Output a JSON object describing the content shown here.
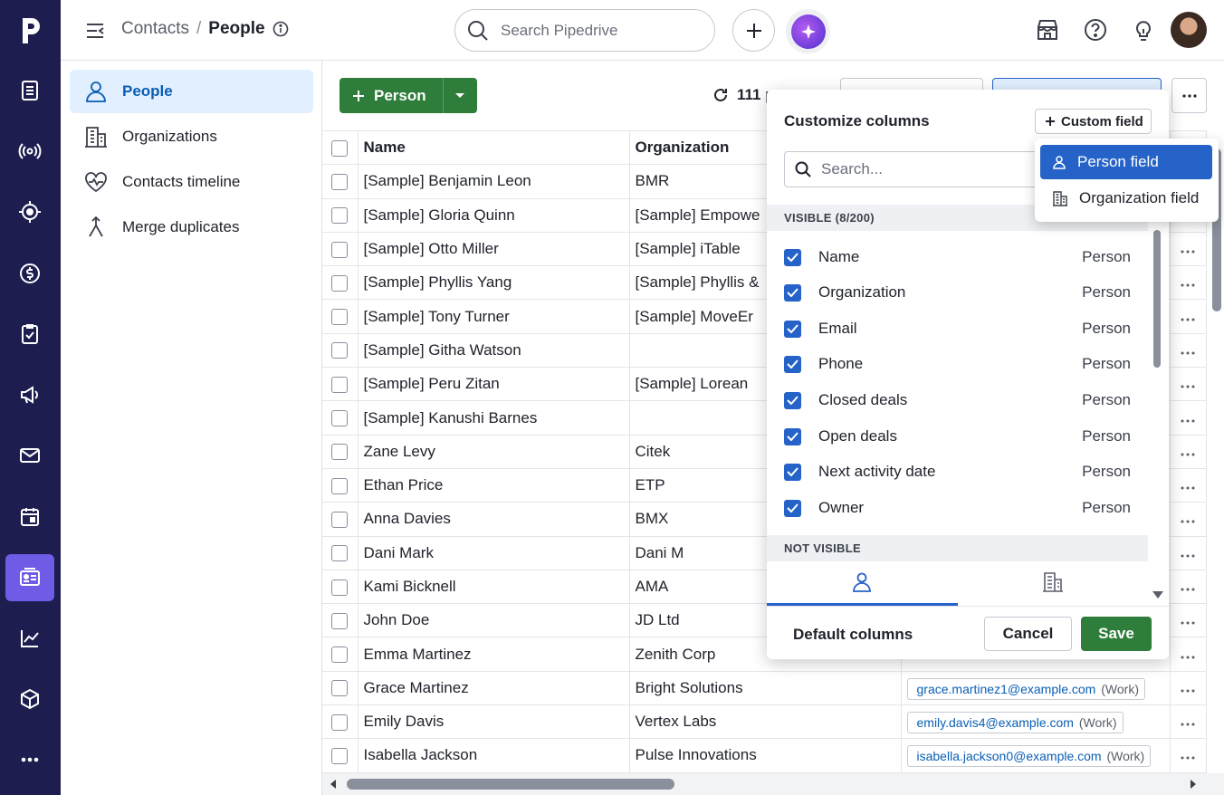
{
  "breadcrumb": {
    "parent": "Contacts",
    "separator": "/",
    "current": "People"
  },
  "search": {
    "placeholder": "Search Pipedrive"
  },
  "sidebar": {
    "items": [
      {
        "label": "People",
        "icon": "person-icon",
        "active": true
      },
      {
        "label": "Organizations",
        "icon": "building-icon",
        "active": false
      },
      {
        "label": "Contacts timeline",
        "icon": "heart-pulse-icon",
        "active": false
      },
      {
        "label": "Merge duplicates",
        "icon": "merge-icon",
        "active": false
      }
    ]
  },
  "toolbar": {
    "add_person_label": "Person",
    "count_label": "111 p"
  },
  "table": {
    "headers": {
      "name": "Name",
      "organization": "Organization"
    },
    "rows": [
      {
        "name": "[Sample] Benjamin Leon",
        "org": "BMR",
        "email": "",
        "tag": ""
      },
      {
        "name": "[Sample] Gloria Quinn",
        "org": "[Sample] Empowe",
        "email": "",
        "tag": ""
      },
      {
        "name": "[Sample] Otto Miller",
        "org": "[Sample] iTable",
        "email": "",
        "tag": ""
      },
      {
        "name": "[Sample] Phyllis Yang",
        "org": "[Sample] Phyllis &",
        "email": "",
        "tag": ""
      },
      {
        "name": "[Sample] Tony Turner",
        "org": "[Sample] MoveEr",
        "email": "",
        "tag": ""
      },
      {
        "name": "[Sample] Githa Watson",
        "org": "",
        "email": "",
        "tag": ""
      },
      {
        "name": "[Sample] Peru Zitan",
        "org": "[Sample] Lorean",
        "email": "",
        "tag": ""
      },
      {
        "name": "[Sample] Kanushi Barnes",
        "org": "",
        "email": "",
        "tag": ""
      },
      {
        "name": "Zane Levy",
        "org": "Citek",
        "email": "",
        "tag": ""
      },
      {
        "name": "Ethan Price",
        "org": "ETP",
        "email": "",
        "tag": ""
      },
      {
        "name": "Anna Davies",
        "org": "BMX",
        "email": "",
        "tag": ""
      },
      {
        "name": "Dani Mark",
        "org": "Dani M",
        "email": "",
        "tag": ""
      },
      {
        "name": "Kami Bicknell",
        "org": "AMA",
        "email": "",
        "tag": ""
      },
      {
        "name": "John Doe",
        "org": "JD Ltd",
        "email": "",
        "tag": ""
      },
      {
        "name": "Emma Martinez",
        "org": "Zenith Corp",
        "email": "",
        "tag": ""
      },
      {
        "name": "Grace Martinez",
        "org": "Bright Solutions",
        "email": "grace.martinez1@example.com",
        "tag": "(Work)"
      },
      {
        "name": "Emily Davis",
        "org": "Vertex Labs",
        "email": "emily.davis4@example.com",
        "tag": "(Work)"
      },
      {
        "name": "Isabella Jackson",
        "org": "Pulse Innovations",
        "email": "isabella.jackson0@example.com",
        "tag": "(Work)"
      }
    ]
  },
  "customize": {
    "title": "Customize columns",
    "custom_field_label": "Custom field",
    "search_placeholder": "Search...",
    "visible_header": "VISIBLE (8/200)",
    "not_visible_header": "NOT VISIBLE",
    "fields": [
      {
        "label": "Name",
        "type": "Person",
        "checked": true
      },
      {
        "label": "Organization",
        "type": "Person",
        "checked": true
      },
      {
        "label": "Email",
        "type": "Person",
        "checked": true
      },
      {
        "label": "Phone",
        "type": "Person",
        "checked": true
      },
      {
        "label": "Closed deals",
        "type": "Person",
        "checked": true
      },
      {
        "label": "Open deals",
        "type": "Person",
        "checked": true
      },
      {
        "label": "Next activity date",
        "type": "Person",
        "checked": true
      },
      {
        "label": "Owner",
        "type": "Person",
        "checked": true
      }
    ],
    "default_columns_label": "Default columns",
    "cancel_label": "Cancel",
    "save_label": "Save"
  },
  "custom_field_menu": {
    "items": [
      {
        "label": "Person field",
        "icon": "person-icon",
        "active": true
      },
      {
        "label": "Organization field",
        "icon": "building-icon",
        "active": false
      }
    ]
  },
  "colors": {
    "rail": "#1e1d4f",
    "rail_active": "#6e5ce6",
    "primary_green": "#2e7d3a",
    "blue": "#2563c8",
    "link": "#0a5fb4"
  }
}
